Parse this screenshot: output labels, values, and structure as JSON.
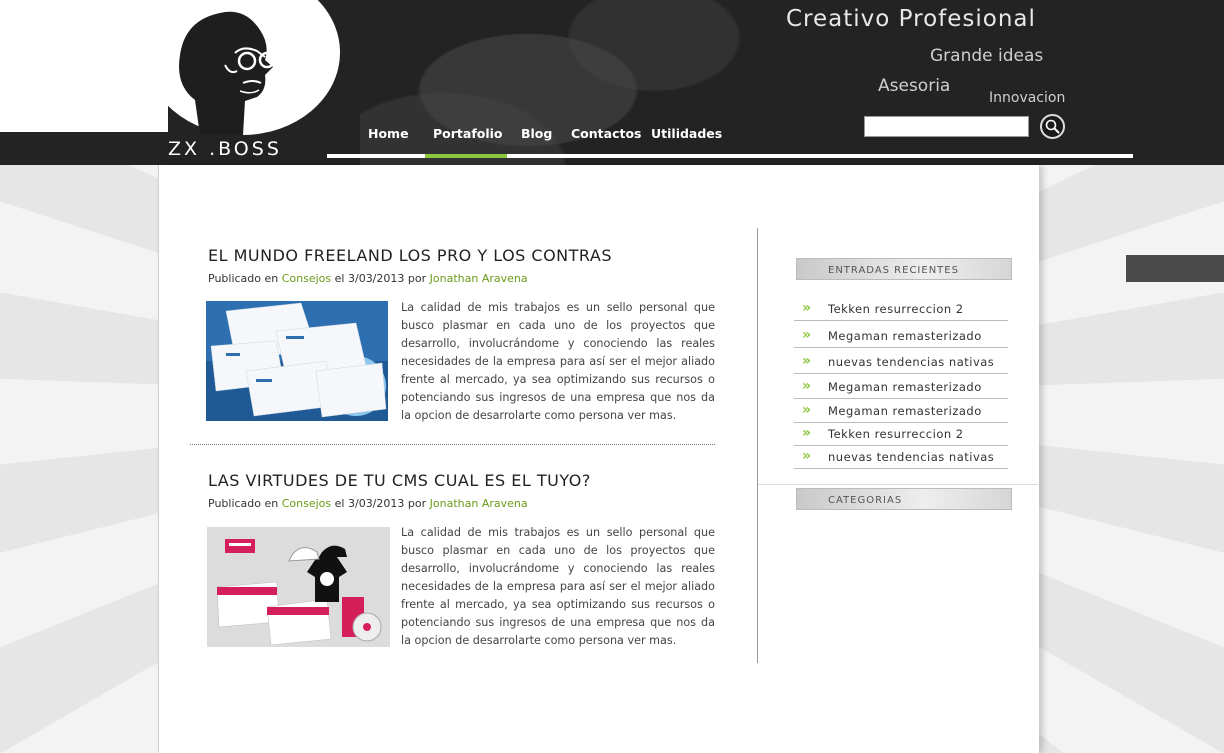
{
  "header": {
    "logo_text": "ZX .BOSS",
    "tagline_main": "Creativo Profesional",
    "tagline_1": "Grande ideas",
    "tagline_2": "Asesoria",
    "tagline_3": "Innovacion",
    "search_placeholder": ""
  },
  "nav": {
    "items": [
      {
        "label": "Home"
      },
      {
        "label": "Portafolio"
      },
      {
        "label": "Blog"
      },
      {
        "label": "Contactos"
      },
      {
        "label": "Utilidades"
      }
    ],
    "active": "Portafolio",
    "accent_color": "#8dc63f"
  },
  "posts": [
    {
      "title": "EL MUNDO FREELAND  LOS PRO Y LOS CONTRAS",
      "meta_prefix": "Publicado en",
      "category": "Consejos",
      "date_prefix": "el",
      "date": "3/03/2013",
      "author_prefix": "por",
      "author": "Jonathan Aravena",
      "body": "La calidad de mis trabajos es un sello personal que busco plasmar en cada uno de los proyectos que desarrollo, involucrándome y conociendo las reales necesidades de la empresa para así ser el mejor aliado frente al mercado, ya sea optimizando sus recursos o potenciando sus ingresos de una empresa que nos da la opcion de desarrolarte como persona ver mas."
    },
    {
      "title": "LAS VIRTUDES DE TU CMS CUAL ES EL TUYO?",
      "meta_prefix": "Publicado en",
      "category": "Consejos",
      "date_prefix": "el",
      "date": "3/03/2013",
      "author_prefix": "por",
      "author": "Jonathan Aravena",
      "body": "La calidad de mis trabajos es un sello personal que busco plasmar en cada uno de los proyectos que desarrollo, involucrándome y conociendo las reales necesidades de la empresa para así ser el mejor aliado frente al mercado, ya sea optimizando sus recursos o potenciando sus ingresos de una empresa que nos da la opcion de desarrolarte como persona ver mas."
    }
  ],
  "sidebar": {
    "recent_title": "ENTRADAS RECIENTES",
    "recent_items": [
      {
        "label": "Tekken  resurreccion  2"
      },
      {
        "label": "Megaman  remasterizado"
      },
      {
        "label": "nuevas  tendencias  nativas"
      },
      {
        "label": "Megaman  remasterizado"
      },
      {
        "label": "Megaman  remasterizado"
      },
      {
        "label": "Tekken  resurreccion  2"
      },
      {
        "label": "nuevas  tendencias  nativas"
      }
    ],
    "categories_title": "CATEGORIAS"
  }
}
